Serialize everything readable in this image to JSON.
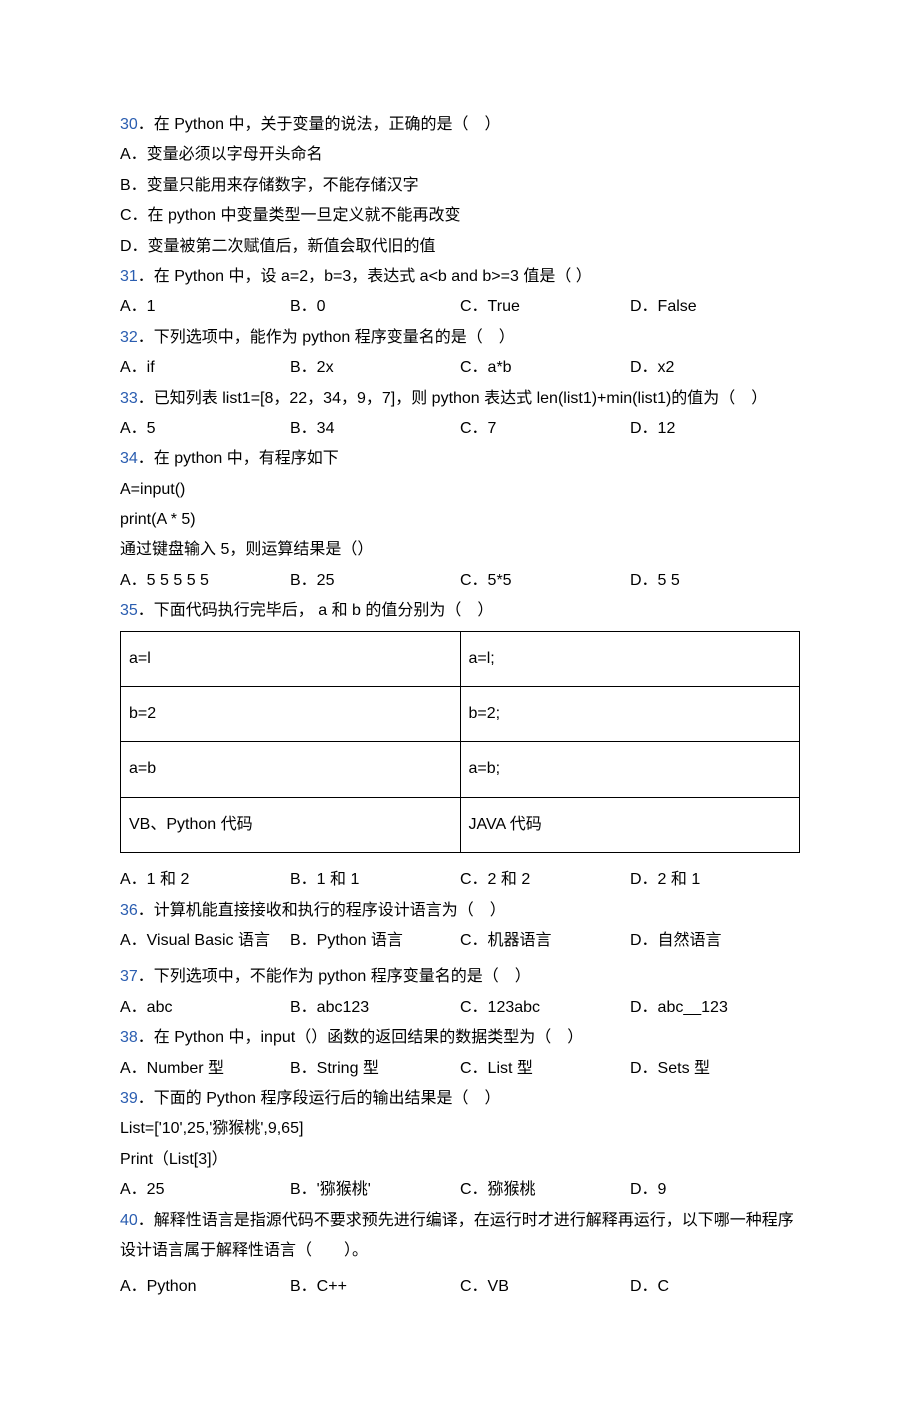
{
  "q30": {
    "num": "30",
    "text": "．在 Python 中，关于变量的说法，正确的是（　）",
    "A": "A．变量必须以字母开头命名",
    "B": "B．变量只能用来存储数字，不能存储汉字",
    "C": "C．在 python 中变量类型一旦定义就不能再改变",
    "D": "D．变量被第二次赋值后，新值会取代旧的值"
  },
  "q31": {
    "num": "31",
    "text": "．在 Python 中，设 a=2，b=3，表达式 a<b and b>=3 值是（ ）",
    "A": "A．1",
    "B": "B．0",
    "C": "C．True",
    "D": "D．False"
  },
  "q32": {
    "num": "32",
    "text": "．下列选项中，能作为 python 程序变量名的是（　）",
    "A": "A．if",
    "B": "B．2x",
    "C": "C．a*b",
    "D": "D．x2"
  },
  "q33": {
    "num": "33",
    "text": "．已知列表 list1=[8，22，34，9，7]，则 python 表达式 len(list1)+min(list1)的值为（　）",
    "A": "A．5",
    "B": "B．34",
    "C": "C．7",
    "D": "D．12"
  },
  "q34": {
    "num": "34",
    "text": "．在 python 中，有程序如下",
    "l1": "A=input()",
    "l2": "print(A * 5)",
    "l3": "通过键盘输入 5，则运算结果是（）",
    "A": "A．5 5 5 5 5",
    "B": "B．25",
    "C": "C．5*5",
    "D": "D．5 5"
  },
  "q35": {
    "num": "35",
    "text": "．下面代码执行完毕后， a 和 b 的值分别为（　）",
    "r1": {
      "L": "a=l",
      "R": "a=l;"
    },
    "r2": {
      "L": "b=2",
      "R": "b=2;"
    },
    "r3": {
      "L": "a=b",
      "R": "a=b;"
    },
    "r4": {
      "L": "VB、Python 代码",
      "R": "JAVA 代码"
    },
    "A": "A．1 和 2",
    "B": "B．1 和 1",
    "C": "C．2 和 2",
    "D": "D．2 和 1"
  },
  "q36": {
    "num": "36",
    "text": "．计算机能直接接收和执行的程序设计语言为（　）",
    "A": "A．Visual Basic 语言",
    "B": "B．Python 语言",
    "C": "C．机器语言",
    "D": "D．自然语言"
  },
  "q37": {
    "num": "37",
    "text": "．下列选项中，不能作为 python 程序变量名的是（　）",
    "A": "A．abc",
    "B": "B．abc123",
    "C": "C．123abc",
    "D": "D．abc__123"
  },
  "q38": {
    "num": "38",
    "text": "．在 Python 中，input（）函数的返回结果的数据类型为（　）",
    "A": "A．Number 型",
    "B": "B．String 型",
    "C": "C．List 型",
    "D": "D．Sets 型"
  },
  "q39": {
    "num": "39",
    "text": "．下面的 Python 程序段运行后的输出结果是（　）",
    "l1": "List=['10',25,'猕猴桃',9,65]",
    "l2": "Print（List[3]）",
    "A": "A．25",
    "B": "B．'猕猴桃'",
    "C": "C．猕猴桃",
    "D": "D．9"
  },
  "q40": {
    "num": "40",
    "text": "．解释性语言是指源代码不要求预先进行编译，在运行时才进行解释再运行，以下哪一种程序设计语言属于解释性语言（　　）。",
    "A": "A．Python",
    "B": "B．C++",
    "C": "C．VB",
    "D": "D．C"
  }
}
